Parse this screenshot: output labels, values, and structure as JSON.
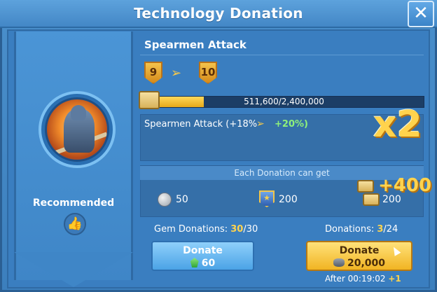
{
  "window": {
    "title": "Technology Donation",
    "close_icon": "close-icon"
  },
  "left": {
    "recommended_label": "Recommended",
    "portrait_icon": "spearman-portrait-icon",
    "thumb_icon": "thumbs-up-icon"
  },
  "tech": {
    "name": "Spearmen Attack",
    "level_from": "9",
    "level_to": "10",
    "progress_text": "511,600/2,400,000",
    "progress_fraction": 0.2132,
    "bonus_label": "Spearmen Attack (+18%",
    "bonus_value": "+20%)",
    "multiplier": "x2"
  },
  "rewards": {
    "heading": "Each Donation can get",
    "silver": "50",
    "badge": "200",
    "scroll": "200",
    "bonus_plus": "+400"
  },
  "donations": {
    "gem_label": "Gem Donations: ",
    "gem_count": "30",
    "gem_total": "/30",
    "donation_label": "Donations: ",
    "donation_count": "3",
    "donation_total": "/24",
    "gem_button": {
      "label": "Donate",
      "cost": "60"
    },
    "stone_button": {
      "label": "Donate",
      "cost": "20,000"
    },
    "after_label": "After 00:19:02",
    "after_plus": "+1"
  },
  "colors": {
    "accent_gold": "#ffd34d",
    "bonus_green": "#8ff17a",
    "panel_blue": "#3a7ec0"
  }
}
